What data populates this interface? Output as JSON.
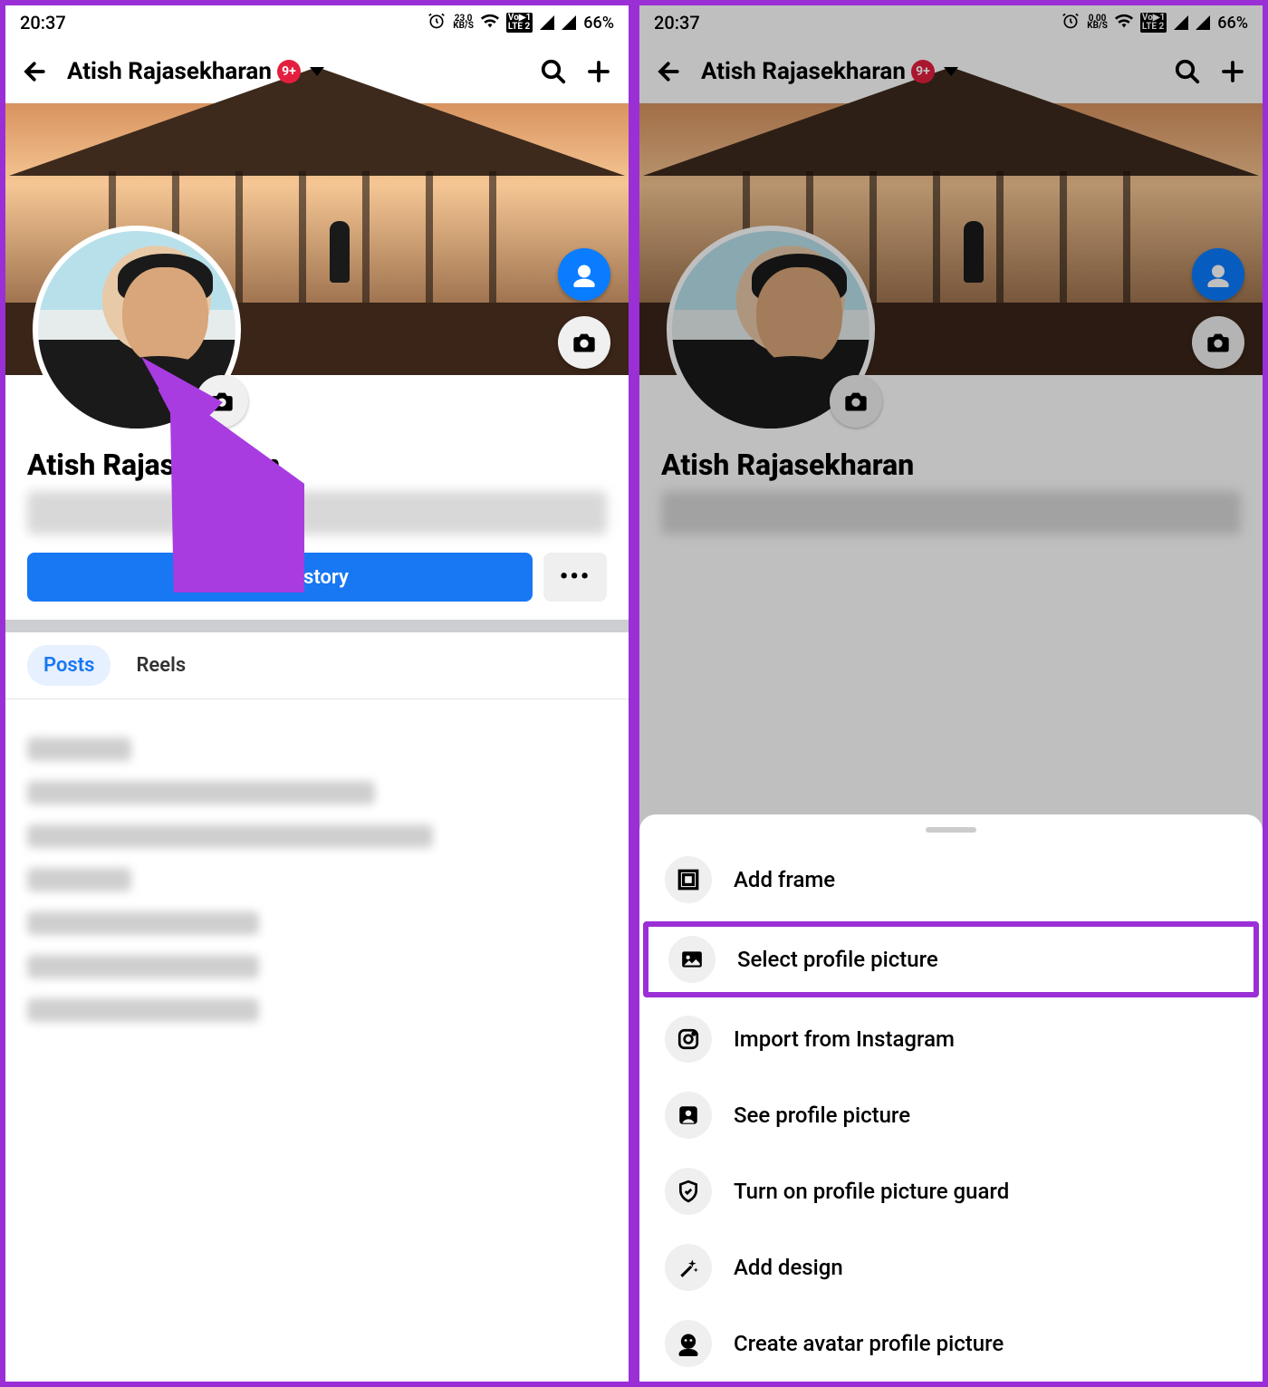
{
  "status": {
    "time": "20:37",
    "kbs_left": "23,0",
    "kbs_right": "0,00",
    "kbs_unit": "KB/S",
    "lte": "VoLTE 2",
    "battery": "66%"
  },
  "header": {
    "title": "Atish Rajasekharan",
    "badge": "9+"
  },
  "profile": {
    "name": "Atish Rajasekharan",
    "add_story": "Add to story",
    "more": "•••"
  },
  "tabs": {
    "posts": "Posts",
    "reels": "Reels"
  },
  "sheet": {
    "add_frame": "Add frame",
    "select_profile": "Select profile picture",
    "import_ig": "Import from Instagram",
    "see_profile": "See profile picture",
    "guard": "Turn on profile picture guard",
    "add_design": "Add design",
    "create_avatar": "Create avatar profile picture"
  },
  "icons": {
    "back": "back-arrow-icon",
    "search": "search-icon",
    "plus": "plus-icon",
    "alarm": "alarm-icon",
    "wifi": "wifi-icon",
    "camera": "camera-icon",
    "avatar_head": "avatar-head-icon"
  },
  "colors": {
    "accent_annotation": "#9b2fd6",
    "fb_blue": "#1877f2",
    "badge_red": "#e41e3f"
  }
}
